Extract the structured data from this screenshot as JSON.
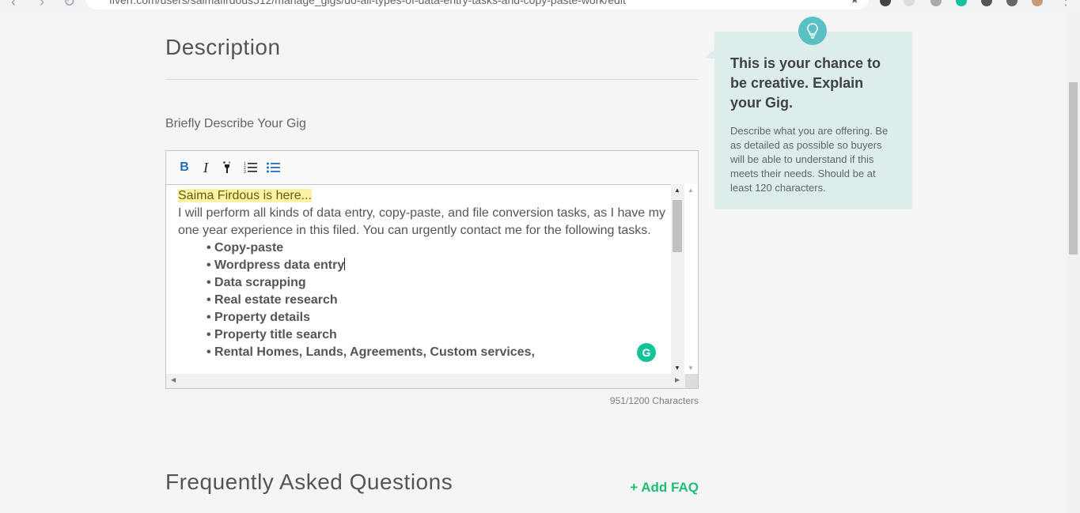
{
  "browser": {
    "url": "fiverr.com/users/saimafirdous512/manage_gigs/do-all-types-of-data-entry-tasks-and-copy-paste-work/edit"
  },
  "description": {
    "title": "Description",
    "field_label": "Briefly Describe Your Gig",
    "intro_highlight": "Saima Firdous is here...",
    "paragraph": "I will perform all kinds of data entry, copy-paste, and file conversion tasks, as I have my one year experience in this filed. You can urgently contact me for the following tasks.",
    "bullets": [
      "Copy-paste",
      "Wordpress data entry",
      "Data scrapping",
      "Real estate research",
      "Property details",
      "Property title search",
      "Rental Homes, Lands, Agreements, Custom services,"
    ],
    "char_count": "951/1200 Characters"
  },
  "toolbar": {
    "bold": "B",
    "italic": "I"
  },
  "faq": {
    "title": "Frequently Asked Questions",
    "add_label": "+ Add FAQ"
  },
  "tip": {
    "heading": "This is your chance to be creative. Explain your Gig.",
    "body": "Describe what you are offering. Be as detailed as possible so buyers will be able to understand if this meets their needs. Should be at least 120 characters."
  },
  "colors": {
    "accent_green": "#1dbf73",
    "tip_bg": "#ddedec",
    "tip_icon_bg": "#5bc0c4",
    "highlight": "#fbf3a5",
    "grammarly": "#15c39a"
  },
  "icons": [
    "back-icon",
    "forward-icon",
    "reload-icon",
    "bookmark-star-icon",
    "lightbulb-icon",
    "bold-icon",
    "italic-icon",
    "paint-format-icon",
    "ordered-list-icon",
    "bullet-list-icon",
    "grammarly-icon"
  ]
}
